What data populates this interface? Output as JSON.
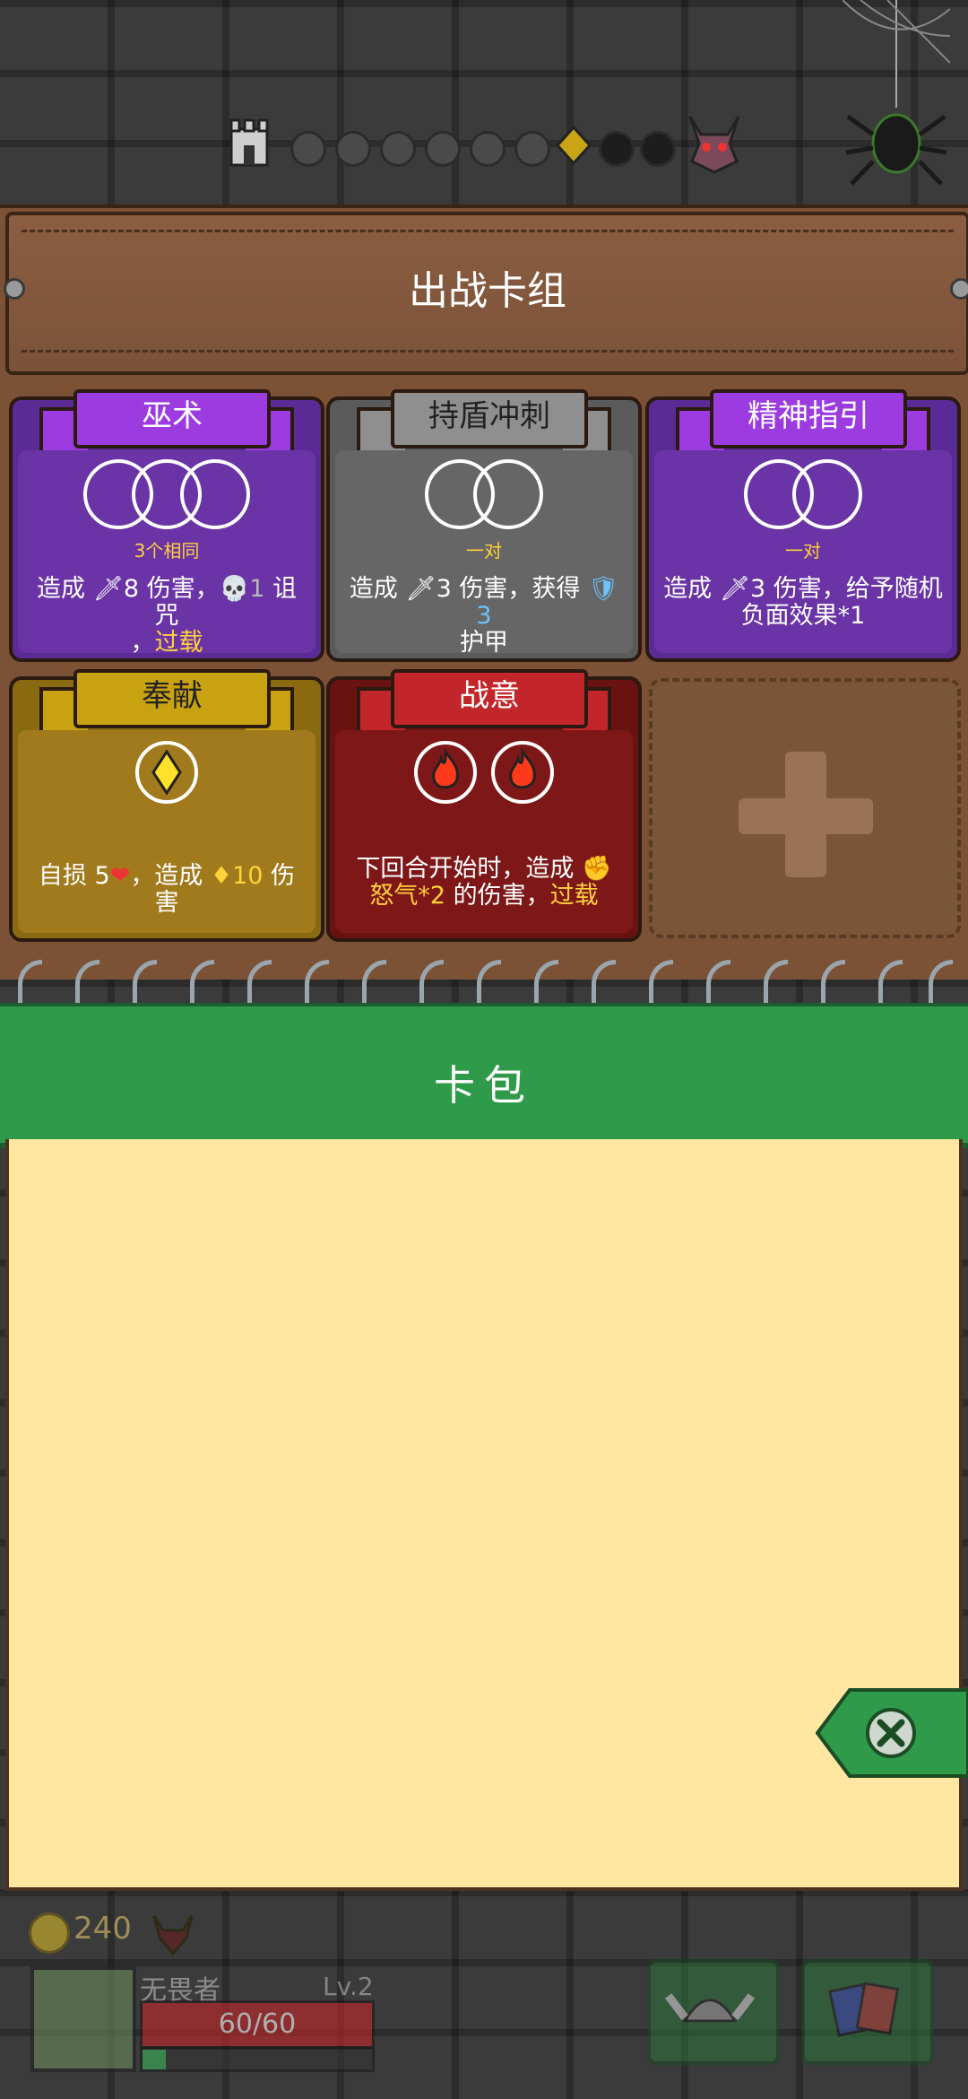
{
  "deck": {
    "title": "出战卡组",
    "cards": [
      {
        "name": "巫术",
        "slots": 3,
        "requirement": "3个相同",
        "desc_parts": [
          "造成 ",
          "🗡8 伤害，",
          "💀1",
          " 诅咒",
          "，",
          "过载"
        ]
      },
      {
        "name": "持盾冲刺",
        "slots": 2,
        "requirement": "一对",
        "desc_a": "造成 🗡3 伤害，获得 ",
        "desc_b": "🛡3",
        "desc_c": "护甲"
      },
      {
        "name": "精神指引",
        "slots": 2,
        "requirement": "一对",
        "desc": "造成 🗡3 伤害，给予随机负面效果*1"
      },
      {
        "name": "奉献",
        "slot_icon": "diamond-icon",
        "desc_a": "自损 5",
        "desc_b": "❤",
        "desc_c": "，造成 ",
        "desc_d": "♦10",
        "desc_e": " 伤害"
      },
      {
        "name": "战意",
        "slot_icon": "fire-icon",
        "slots": 2,
        "desc_a": "下回合开始时，造成 ",
        "desc_b": "✊怒气*2",
        "desc_c": " 的伤害，",
        "desc_d": "过载"
      }
    ],
    "empty_slot_icon": "plus-icon"
  },
  "pack": {
    "title": "卡包"
  },
  "player": {
    "coins": "240",
    "name": "无畏者",
    "level": "Lv.2",
    "hp": "60/60",
    "xp_fraction": 0.1
  },
  "colors": {
    "purple": "#6a34a6",
    "gray": "#666666",
    "gold": "#a07a1c",
    "red": "#7e1818",
    "pack_green": "#2f9a4a",
    "parchment": "#ffe7a2"
  },
  "icons": [
    "castle-icon",
    "boss-icon",
    "spider-icon",
    "coin-icon",
    "demon-icon",
    "close-icon",
    "helmet-icon",
    "cards-icon"
  ]
}
